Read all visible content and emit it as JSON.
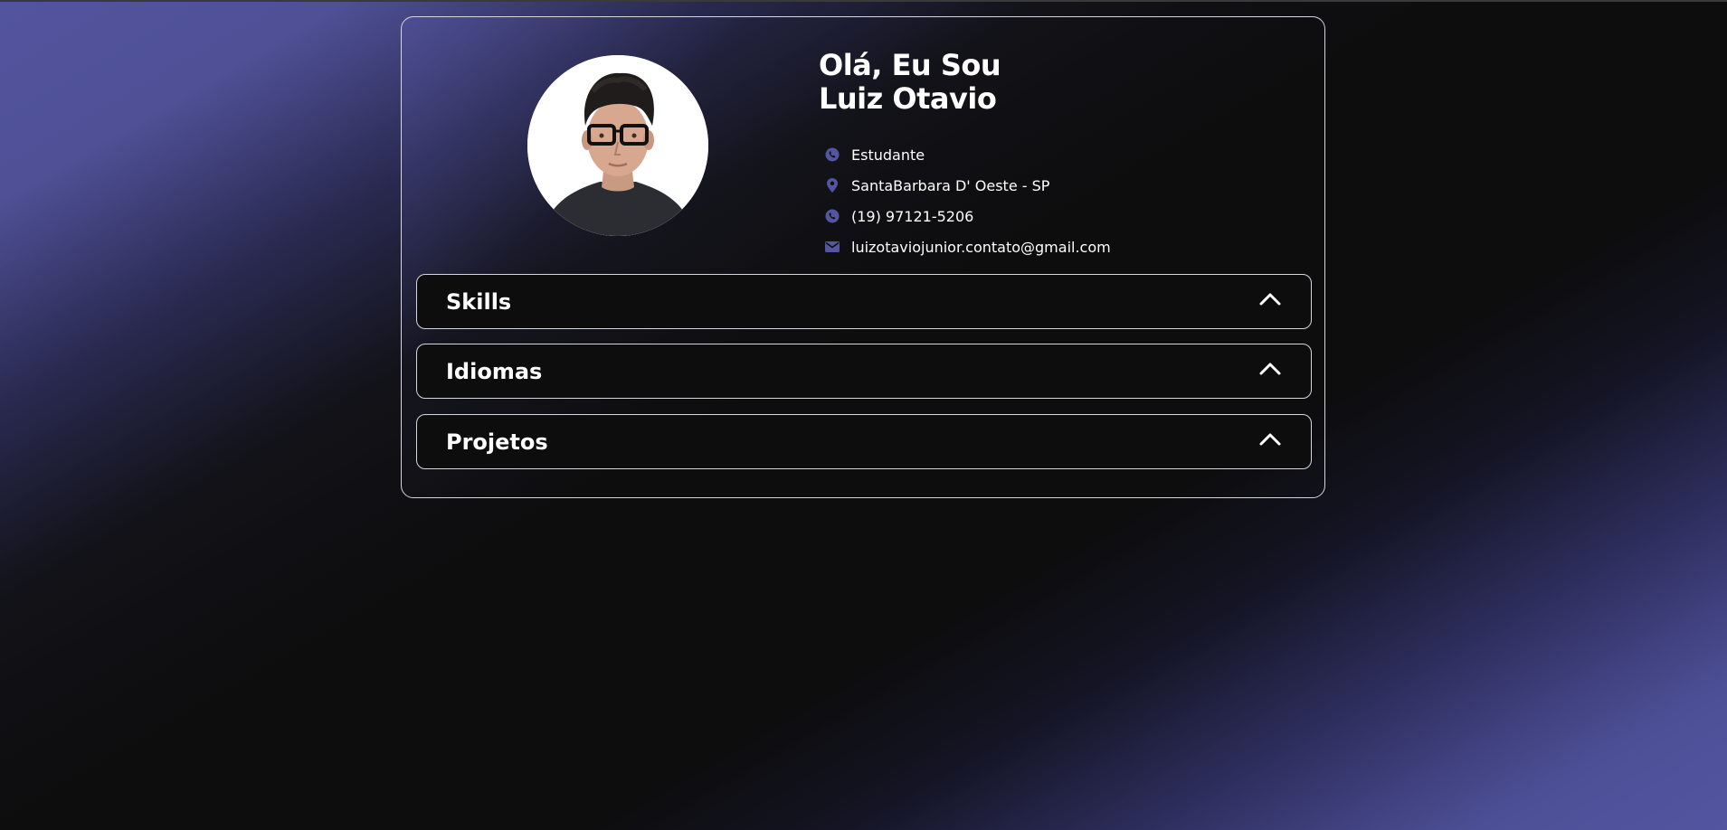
{
  "profile": {
    "greeting_line1": "Olá, Eu Sou",
    "greeting_line2": "Luiz Otavio",
    "avatar_alt": "Luiz Otavio"
  },
  "info": [
    {
      "icon": "whatsapp-icon",
      "text": "Estudante"
    },
    {
      "icon": "location-pin-icon",
      "text": "SantaBarbara D' Oeste - SP"
    },
    {
      "icon": "whatsapp-icon",
      "text": "(19) 97121-5206"
    },
    {
      "icon": "email-icon",
      "text": "luizotaviojunior.contato@gmail.com"
    }
  ],
  "sections": [
    {
      "title": "Skills",
      "icon": "chevron-up-icon"
    },
    {
      "title": "Idiomas",
      "icon": "chevron-up-icon"
    },
    {
      "title": "Projetos",
      "icon": "chevron-up-icon"
    }
  ],
  "colors": {
    "accent": "#5355a0",
    "background": "#0d0d0e",
    "border": "#d6d6e0",
    "text": "#ffffff"
  }
}
